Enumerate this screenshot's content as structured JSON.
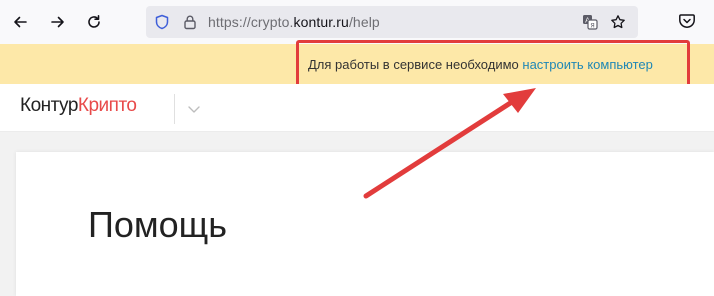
{
  "browser": {
    "url_prefix": "https://crypto.",
    "url_domain": "kontur.ru",
    "url_suffix": "/help",
    "icons": [
      "back-arrow-icon",
      "forward-arrow-icon",
      "reload-icon",
      "shield-icon",
      "lock-icon",
      "translate-icon",
      "star-icon",
      "pocket-icon"
    ]
  },
  "banner": {
    "text": "Для работы в сервисе необходимо",
    "link_text": "настроить компьютер"
  },
  "header": {
    "logo_part1": "Контур",
    "logo_part2": "Крипто"
  },
  "main": {
    "title": "Помощь"
  },
  "colors": {
    "banner_bg": "#fde8a8",
    "link": "#1f87b5",
    "brand_red": "#e84a4a",
    "annotation_red": "#e23c3c"
  }
}
